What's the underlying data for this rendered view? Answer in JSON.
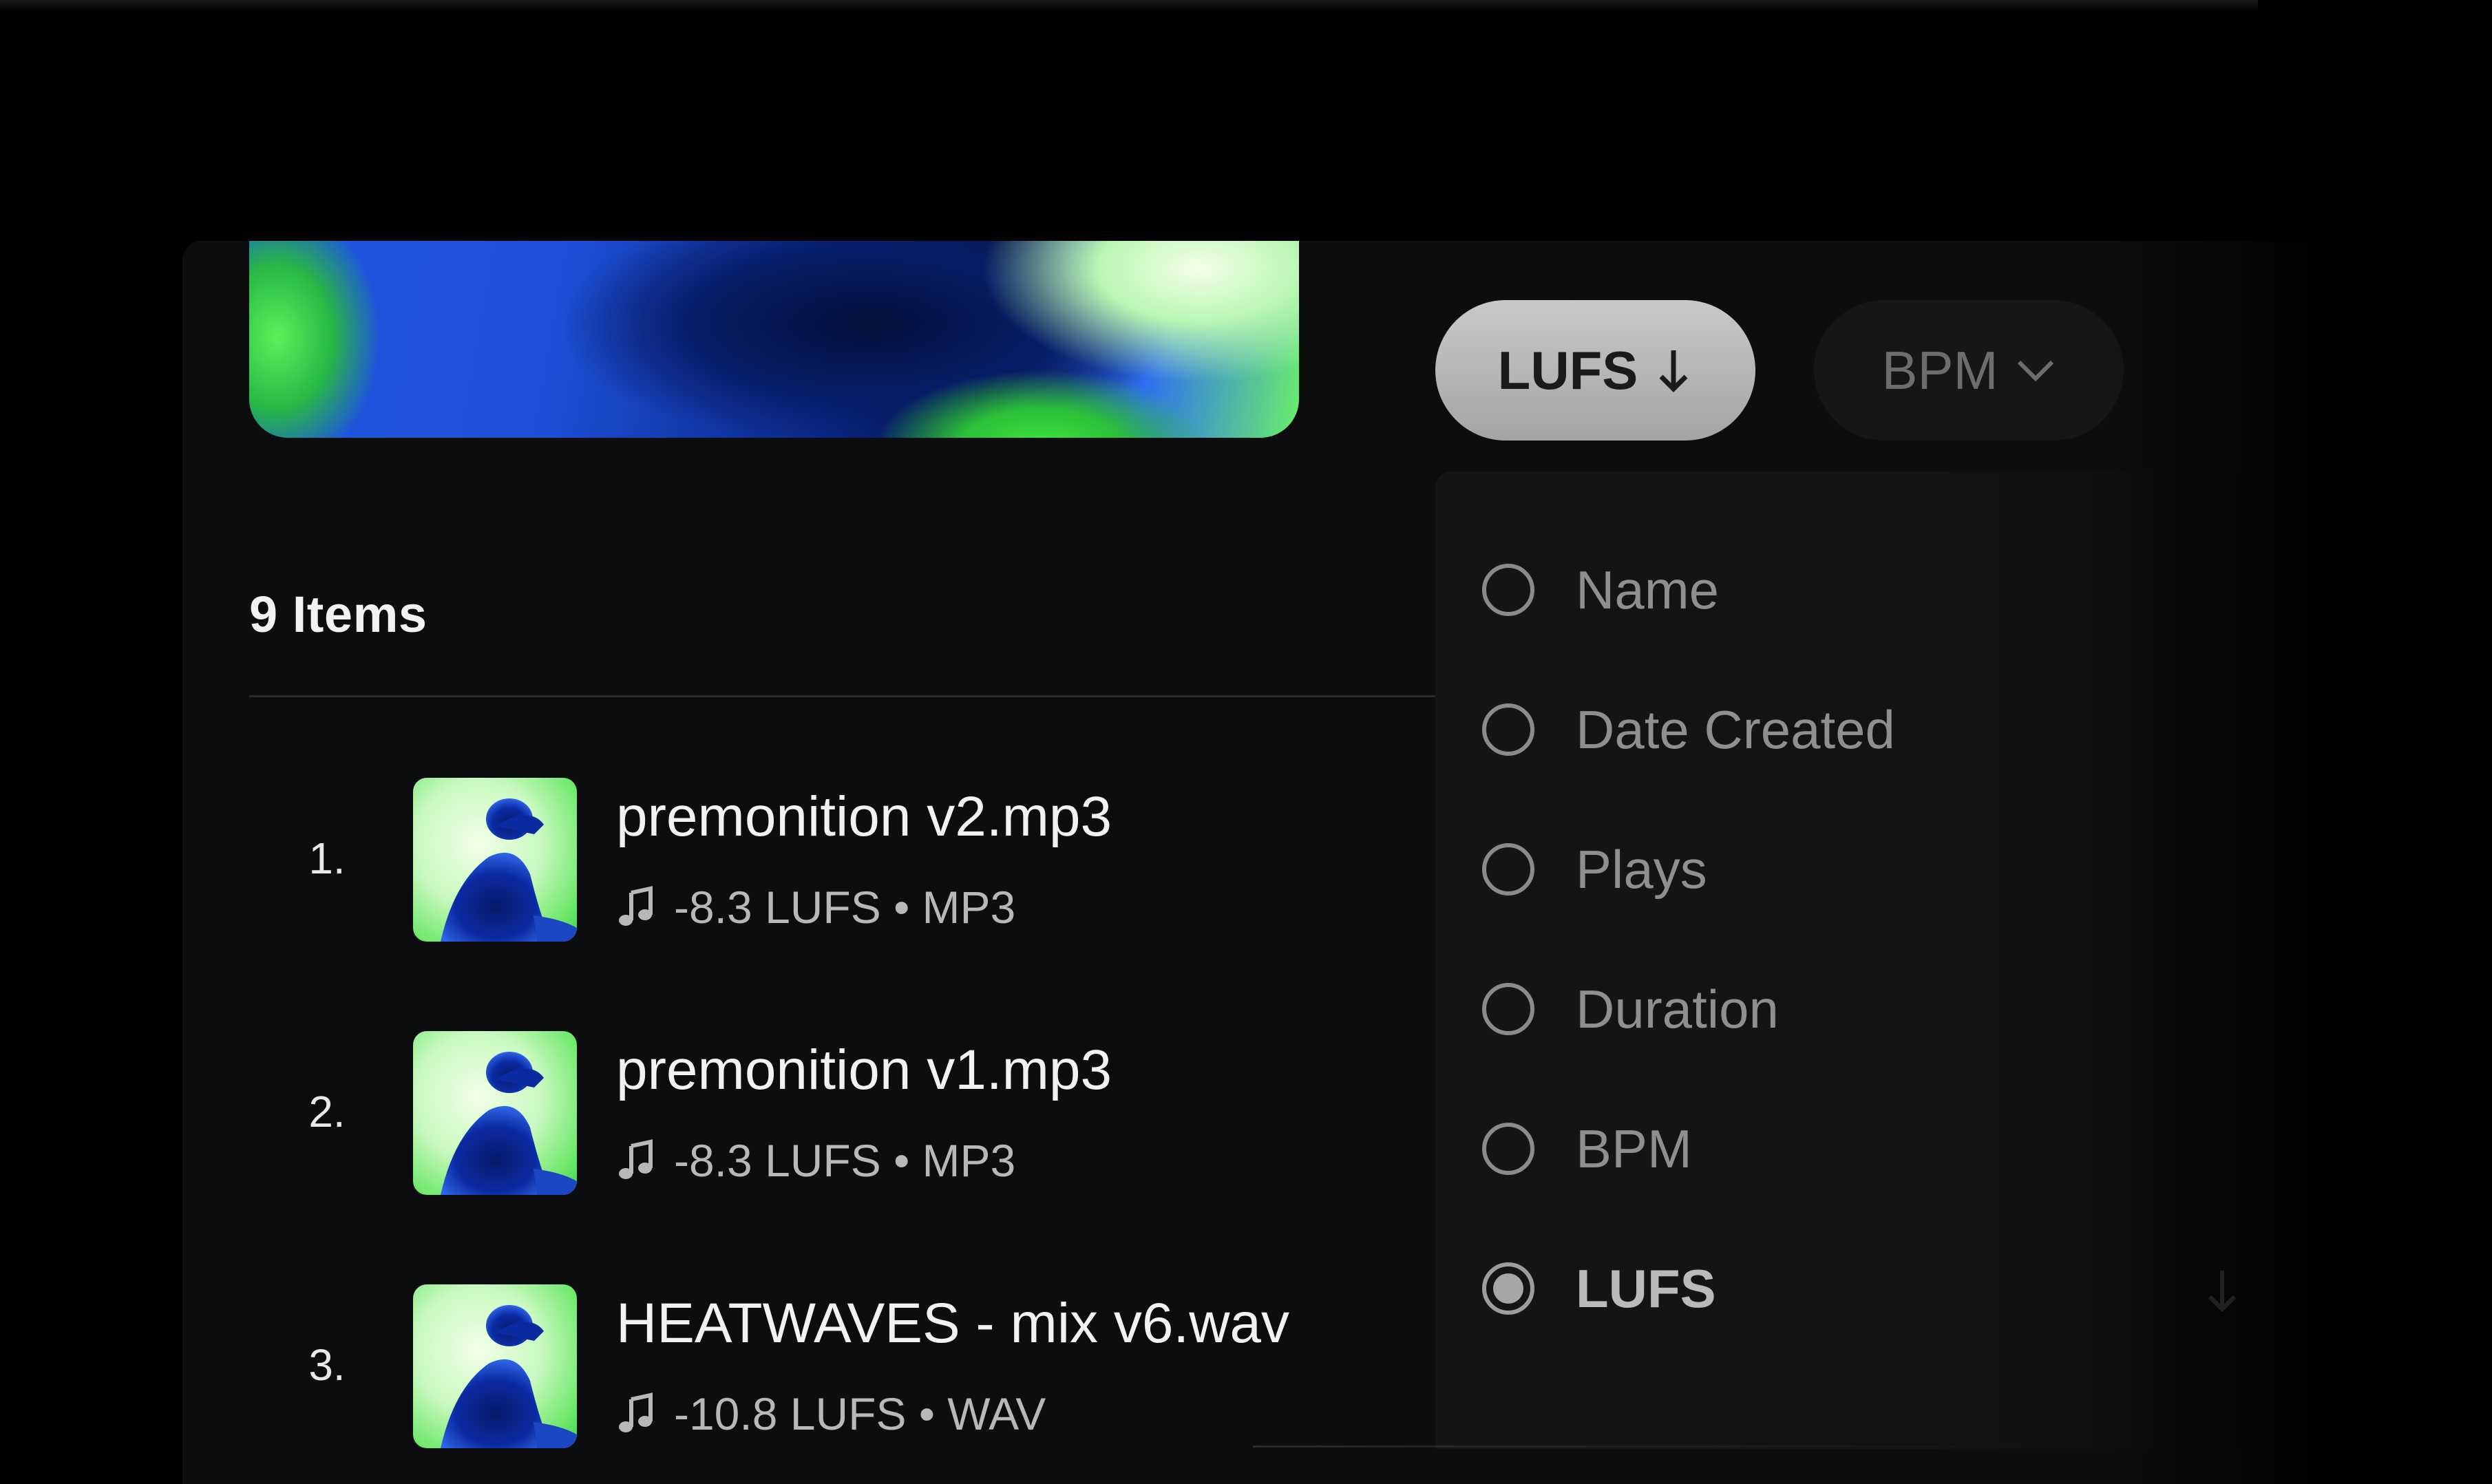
{
  "list": {
    "count_label": "9 Items",
    "items": [
      {
        "index": "1.",
        "title": "premonition v2.mp3",
        "meta": "-8.3 LUFS • MP3"
      },
      {
        "index": "2.",
        "title": "premonition v1.mp3",
        "meta": "-8.3 LUFS • MP3"
      },
      {
        "index": "3.",
        "title": "HEATWAVES - mix v6.wav",
        "meta": "-10.8 LUFS • WAV"
      }
    ]
  },
  "sort": {
    "active_chip_label": "LUFS",
    "active_chip_icon": "arrow-down-icon",
    "secondary_chip_label": "BPM",
    "secondary_chip_icon": "chevron-down-icon",
    "options": [
      {
        "label": "Name",
        "selected": false
      },
      {
        "label": "Date Created",
        "selected": false
      },
      {
        "label": "Plays",
        "selected": false
      },
      {
        "label": "Duration",
        "selected": false
      },
      {
        "label": "BPM",
        "selected": false
      },
      {
        "label": "LUFS",
        "selected": true
      }
    ]
  },
  "colors": {
    "background": "#000000",
    "panel": "#0c0d0e",
    "active_chip": "#b8b8b8",
    "accent_green": "#4be84a",
    "accent_blue": "#1d4fd6"
  }
}
